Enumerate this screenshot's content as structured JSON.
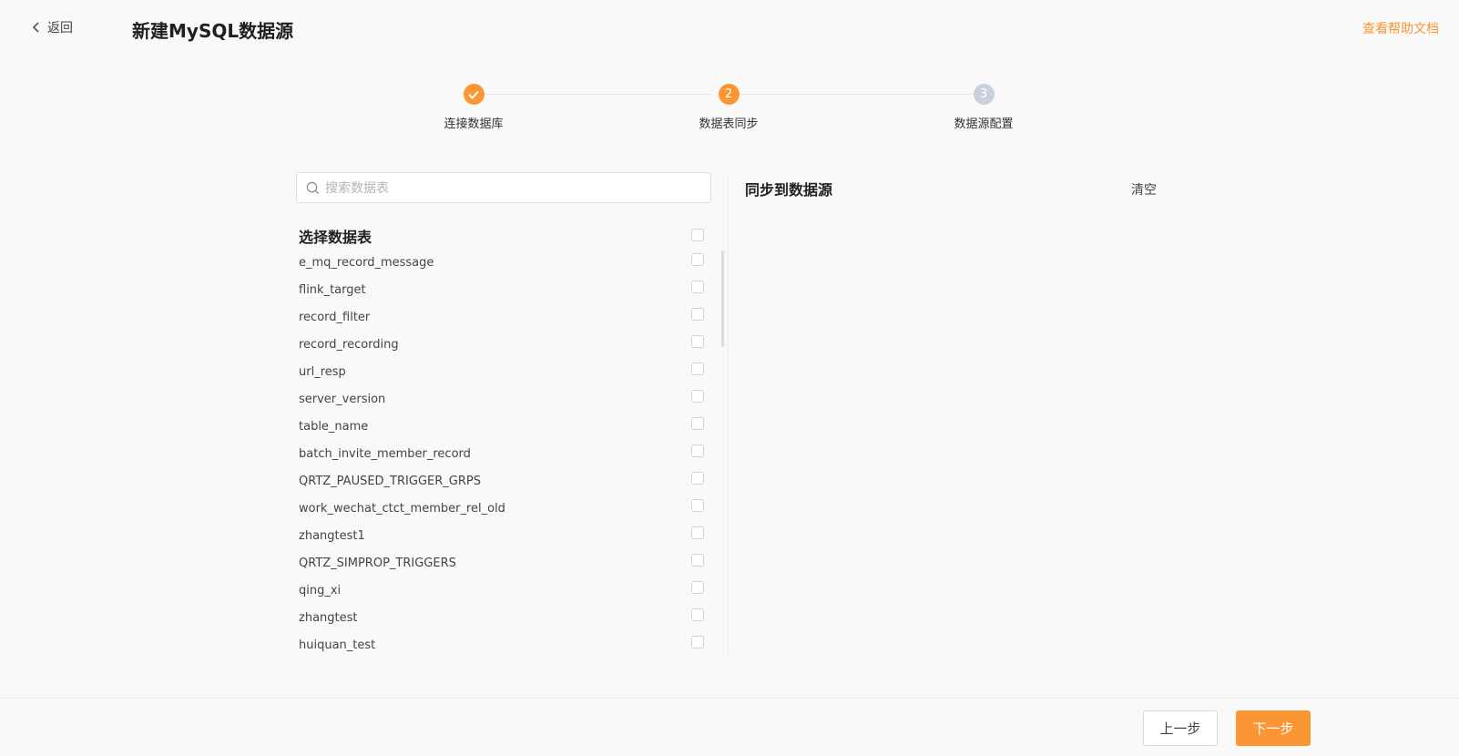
{
  "header": {
    "back_label": "返回",
    "title": "新建MySQL数据源",
    "help_link": "查看帮助文档"
  },
  "stepper": {
    "steps": [
      {
        "number": "1",
        "label": "连接数据库",
        "status": "done"
      },
      {
        "number": "2",
        "label": "数据表同步",
        "status": "active"
      },
      {
        "number": "3",
        "label": "数据源配置",
        "status": "pending"
      }
    ]
  },
  "left_panel": {
    "search_placeholder": "搜索数据表",
    "list_title": "选择数据表",
    "tables": [
      "e_mq_record_message",
      "flink_target",
      "record_filter",
      "record_recording",
      "url_resp",
      "server_version",
      "table_name",
      "batch_invite_member_record",
      "QRTZ_PAUSED_TRIGGER_GRPS",
      "work_wechat_ctct_member_rel_old",
      "zhangtest1",
      "QRTZ_SIMPROP_TRIGGERS",
      "qing_xi",
      "zhangtest",
      "huiquan_test"
    ]
  },
  "right_panel": {
    "title": "同步到数据源",
    "clear_label": "清空"
  },
  "footer": {
    "prev_label": "上一步",
    "next_label": "下一步"
  },
  "colors": {
    "accent": "#fa9634",
    "pending_step": "#c8d1dc",
    "background": "#f9f9f9"
  }
}
